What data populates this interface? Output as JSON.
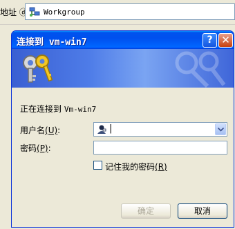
{
  "address_bar": {
    "label": "地址 ⓓ",
    "value": "Workgroup",
    "icon": "network-icon"
  },
  "dialog": {
    "title": "连接到 vm-win7",
    "help_label": "?",
    "close_label": "✕",
    "connecting_prefix": "正在连接到 ",
    "connecting_host": "Vm-win7",
    "username_label": "用户名",
    "username_accel": "(U)",
    "username_value": "|",
    "password_label": "密码",
    "password_accel": "(P)",
    "password_value": "",
    "remember_label": "记住我的密码",
    "remember_accel": "(R)",
    "remember_checked": false,
    "ok_label": "确定",
    "cancel_label": "取消"
  },
  "colors": {
    "title_blue": "#0053ee",
    "dialog_bg": "#ece9d8"
  }
}
